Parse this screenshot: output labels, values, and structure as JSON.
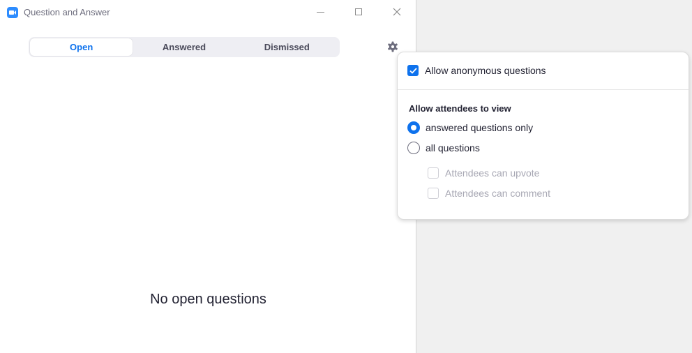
{
  "window": {
    "title": "Question and Answer"
  },
  "tabs": [
    {
      "label": "Open",
      "active": true
    },
    {
      "label": "Answered",
      "active": false
    },
    {
      "label": "Dismissed",
      "active": false
    }
  ],
  "empty_state": {
    "text": "No open questions"
  },
  "settings": {
    "allow_anonymous": {
      "label": "Allow anonymous questions",
      "checked": true
    },
    "view_section_title": "Allow attendees to view",
    "view_options": [
      {
        "label": "answered questions only",
        "selected": true
      },
      {
        "label": "all questions",
        "selected": false
      }
    ],
    "sub_options": [
      {
        "label": "Attendees can upvote",
        "checked": false,
        "disabled": true
      },
      {
        "label": "Attendees can comment",
        "checked": false,
        "disabled": true
      }
    ]
  },
  "colors": {
    "accent": "#0e72ed",
    "brand": "#2d8cff",
    "disabled_text": "#a7a7b3"
  },
  "icons": {
    "app": "zoom-logo-icon",
    "settings": "gear-icon",
    "minimize": "minimize-icon",
    "maximize": "maximize-icon",
    "close": "close-icon"
  }
}
